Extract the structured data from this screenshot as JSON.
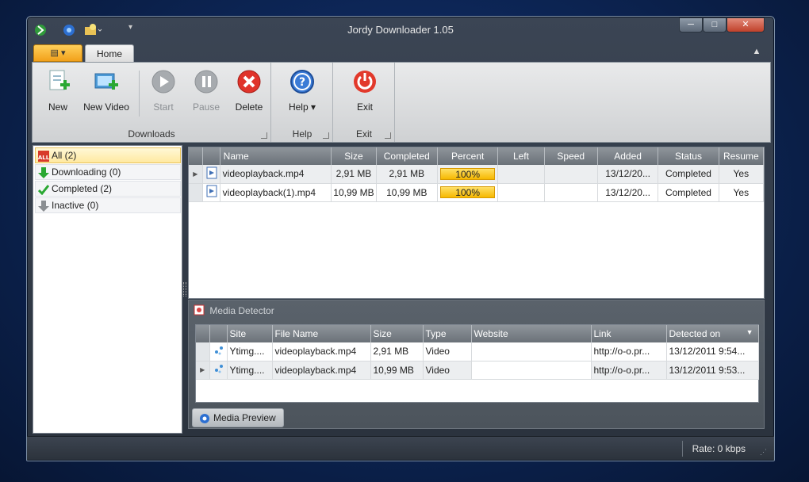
{
  "window": {
    "title": "Jordy Downloader 1.05"
  },
  "ribbon": {
    "tab": "Home",
    "groups": {
      "downloads": "Downloads",
      "help": "Help",
      "exit": "Exit"
    },
    "buttons": {
      "new": "New",
      "new_video": "New Video",
      "start": "Start",
      "pause": "Pause",
      "delete": "Delete",
      "help": "Help ▾",
      "exit": "Exit"
    }
  },
  "filters": [
    {
      "label": "All (2)",
      "icon": "all-icon",
      "selected": true
    },
    {
      "label": "Downloading (0)",
      "icon": "download-arrow-icon",
      "selected": false
    },
    {
      "label": "Completed (2)",
      "icon": "checkmark-icon",
      "selected": false
    },
    {
      "label": "Inactive (0)",
      "icon": "inactive-arrow-icon",
      "selected": false
    }
  ],
  "downloads": {
    "columns": [
      "Name",
      "Size",
      "Completed",
      "Percent",
      "Left",
      "Speed",
      "Added",
      "Status",
      "Resume"
    ],
    "rows": [
      {
        "name": "videoplayback.mp4",
        "size": "2,91 MB",
        "completed": "2,91 MB",
        "percent": "100%",
        "left": "",
        "speed": "",
        "added": "13/12/20...",
        "status": "Completed",
        "resume": "Yes"
      },
      {
        "name": "videoplayback(1).mp4",
        "size": "10,99 MB",
        "completed": "10,99 MB",
        "percent": "100%",
        "left": "",
        "speed": "",
        "added": "13/12/20...",
        "status": "Completed",
        "resume": "Yes"
      }
    ]
  },
  "media_detector": {
    "title": "Media Detector",
    "columns": [
      "Site",
      "File Name",
      "Size",
      "Type",
      "Website",
      "Link",
      "Detected on"
    ],
    "rows": [
      {
        "site": "Ytimg....",
        "file": "videoplayback.mp4",
        "size": "2,91 MB",
        "type": "Video",
        "website": "",
        "link": "http://o-o.pr...",
        "detected": "13/12/2011 9:54..."
      },
      {
        "site": "Ytimg....",
        "file": "videoplayback.mp4",
        "size": "10,99 MB",
        "type": "Video",
        "website": "",
        "link": "http://o-o.pr...",
        "detected": "13/12/2011 9:53..."
      }
    ]
  },
  "media_preview": {
    "label": "Media Preview"
  },
  "statusbar": {
    "rate": "Rate: 0 kbps"
  },
  "colors": {
    "accent": "#f6b800",
    "titlebar": "#2a323d",
    "header": "#6a7178"
  }
}
